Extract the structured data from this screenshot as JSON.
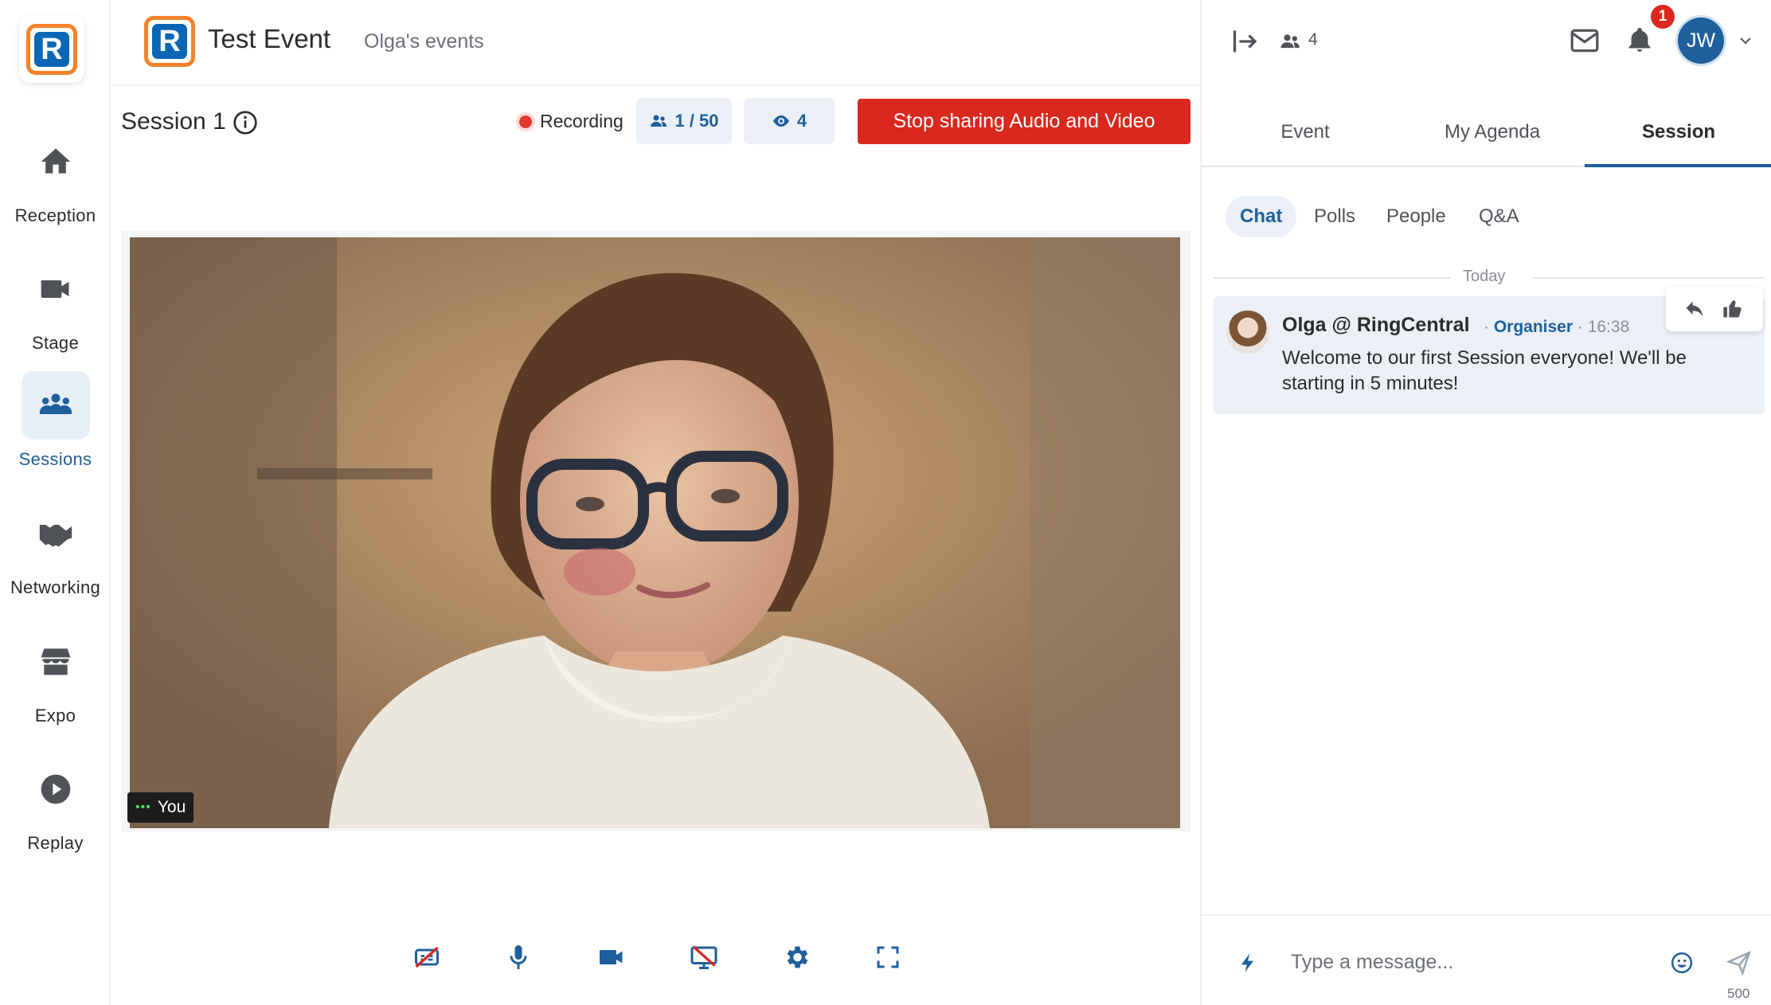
{
  "app": {
    "logo_letter": "R"
  },
  "nav": {
    "items": [
      {
        "label": "Reception",
        "icon": "home-icon"
      },
      {
        "label": "Stage",
        "icon": "video-camera-icon"
      },
      {
        "label": "Sessions",
        "icon": "group-icon",
        "active": true
      },
      {
        "label": "Networking",
        "icon": "handshake-icon"
      },
      {
        "label": "Expo",
        "icon": "store-icon"
      },
      {
        "label": "Replay",
        "icon": "play-circle-icon"
      }
    ]
  },
  "header": {
    "event_title": "Test Event",
    "event_subtitle": "Olga's events"
  },
  "session": {
    "title": "Session 1",
    "recording_label": "Recording",
    "attendees_pill": "1 / 50",
    "viewers_pill": "4",
    "stop_button": "Stop sharing Audio and Video"
  },
  "video": {
    "self_label": "You",
    "status_dots": "•••"
  },
  "controls": [
    {
      "name": "captions-off-icon"
    },
    {
      "name": "microphone-icon"
    },
    {
      "name": "camera-icon"
    },
    {
      "name": "screen-share-off-icon"
    },
    {
      "name": "settings-gear-icon"
    },
    {
      "name": "fullscreen-icon"
    }
  ],
  "right_panel": {
    "attendee_count": "4",
    "notification_count": "1",
    "avatar_initials": "JW",
    "tabs": [
      "Event",
      "My Agenda",
      "Session"
    ],
    "active_tab": "Session",
    "subtabs": [
      "Chat",
      "Polls",
      "People",
      "Q&A"
    ],
    "active_subtab": "Chat",
    "day_divider": "Today",
    "messages": [
      {
        "author": "Olga @ RingCentral",
        "role": "Organiser",
        "time": "16:38",
        "text": "Welcome to our first Session everyone! We'll be starting in 5 minutes!"
      }
    ],
    "composer_placeholder": "Type a message...",
    "char_limit": "500"
  },
  "colors": {
    "accent": "#1f5f9c",
    "danger": "#d9281e",
    "brand_orange": "#f4822a",
    "active_bg": "#eaf0f6"
  }
}
